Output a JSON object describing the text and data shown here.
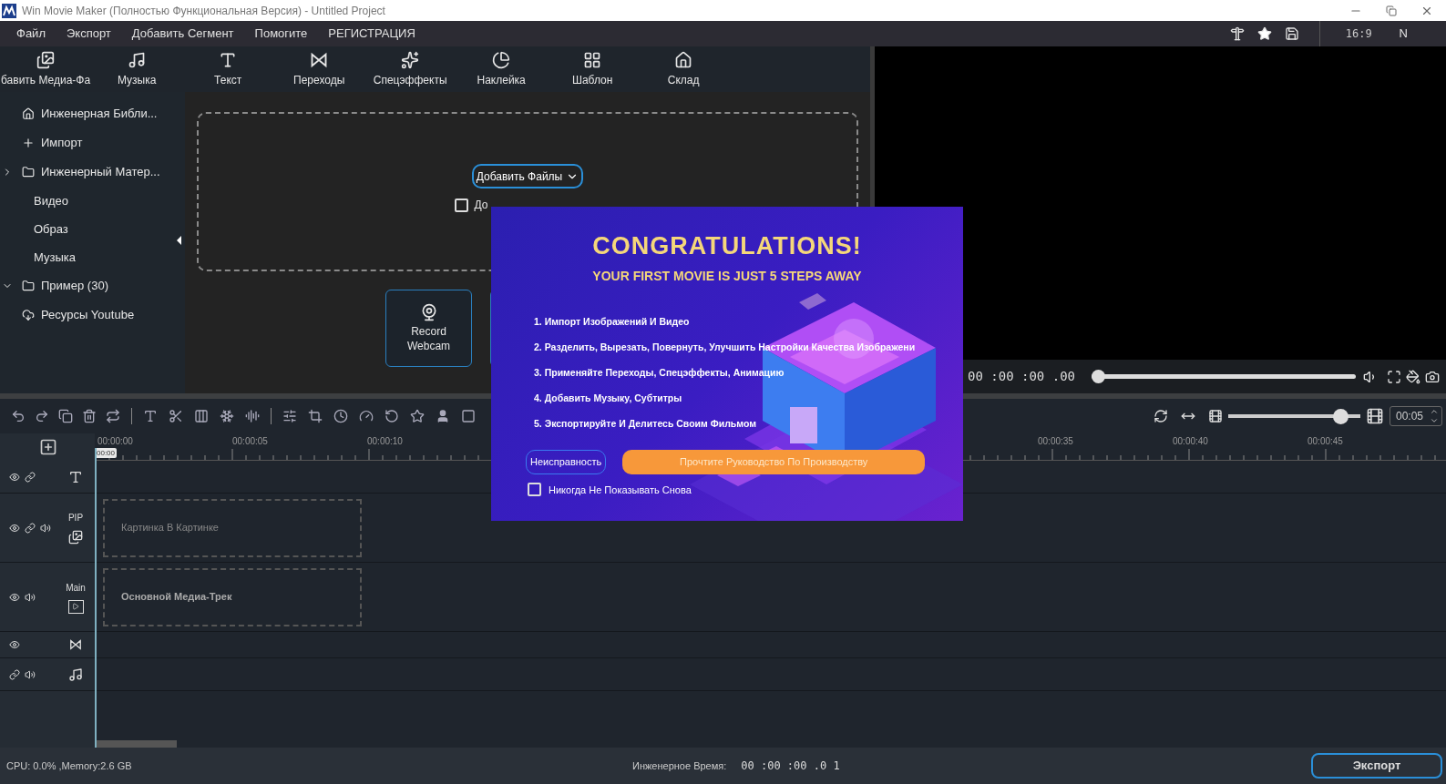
{
  "window": {
    "title": "Win Movie Maker (Полностью Функциональная Версия) - Untitled Project"
  },
  "menu": [
    "Файл",
    "Экспорт",
    "Добавить Сегмент",
    "Помогите",
    "РЕГИСТРАЦИЯ"
  ],
  "menu_right": {
    "aspect": "16:9",
    "user": "N"
  },
  "toolbar": [
    {
      "kind": "media",
      "label": "бавить Медиа-Фа"
    },
    {
      "kind": "music",
      "label": "Музыка"
    },
    {
      "kind": "text",
      "label": "Текст"
    },
    {
      "kind": "transition",
      "label": "Переходы"
    },
    {
      "kind": "effects",
      "label": "Спецэффекты"
    },
    {
      "kind": "sticker",
      "label": "Наклейка"
    },
    {
      "kind": "template",
      "label": "Шаблон"
    },
    {
      "kind": "store",
      "label": "Склад"
    }
  ],
  "sidebar": {
    "items": [
      {
        "kind": "home",
        "label": "Инженерная Библи..."
      },
      {
        "kind": "import",
        "label": "Импорт"
      },
      {
        "kind": "folder",
        "label": "Инженерный Матер...",
        "expanded": false,
        "children": [
          {
            "label": "Видео"
          },
          {
            "label": "Образ"
          },
          {
            "label": "Музыка"
          }
        ]
      },
      {
        "kind": "folder",
        "label": "Пример (30)",
        "expanded": true
      },
      {
        "kind": "cloud",
        "label": "Ресурсы Youtube"
      }
    ]
  },
  "import_area": {
    "add_button": "Добавить Файлы",
    "checkbox": {
      "label": "До",
      "checked": false
    },
    "webcam_button": "Record Webcam"
  },
  "preview": {
    "timecode": "00 :00 :00 .00",
    "level": 0
  },
  "timeline": {
    "ruler_left": [
      "00:00:00",
      "00:00:05",
      "00:00:10"
    ],
    "ruler_right": [
      "00:00:35",
      "00:00:40",
      "00:00:45"
    ],
    "playhead": "00:00",
    "zoom": {
      "level": 0.9
    },
    "duration": "00:05",
    "tracks": [
      {
        "kind": "text"
      },
      {
        "kind": "pip",
        "label": "PIP",
        "placeholder": "Картинка В Картинке"
      },
      {
        "kind": "main",
        "label": "Main",
        "placeholder": "Основной Медиа-Трек"
      },
      {
        "kind": "transition"
      },
      {
        "kind": "audio"
      }
    ]
  },
  "status_bar": {
    "usage": "CPU: 0.0% ,Memory:2.6 GB",
    "time_label": "Инженерное Время:",
    "time": "00 :00 :00 .0 1",
    "export": "Экспорт"
  },
  "dialog": {
    "title": "CONGRATULATIONS!",
    "subtitle": "YOUR FIRST MOVIE IS JUST 5 STEPS AWAY",
    "steps": [
      "1. Импорт Изображений И Видео",
      "2. Разделить, Вырезать, Повернуть, Улучшить Настройки Качества Изображени",
      "3. Применяйте Переходы, Спецэффекты, Анимацию",
      "4. Добавить Музыку, Субтитры",
      "5. Экспортируйте И Делитесь Своим Фильмом"
    ],
    "secondary_button": "Неисправность",
    "primary_button": "Прочтите Руководство По Производству",
    "never_show": {
      "label": "Никогда Не Показывать Снова",
      "checked": false
    }
  }
}
